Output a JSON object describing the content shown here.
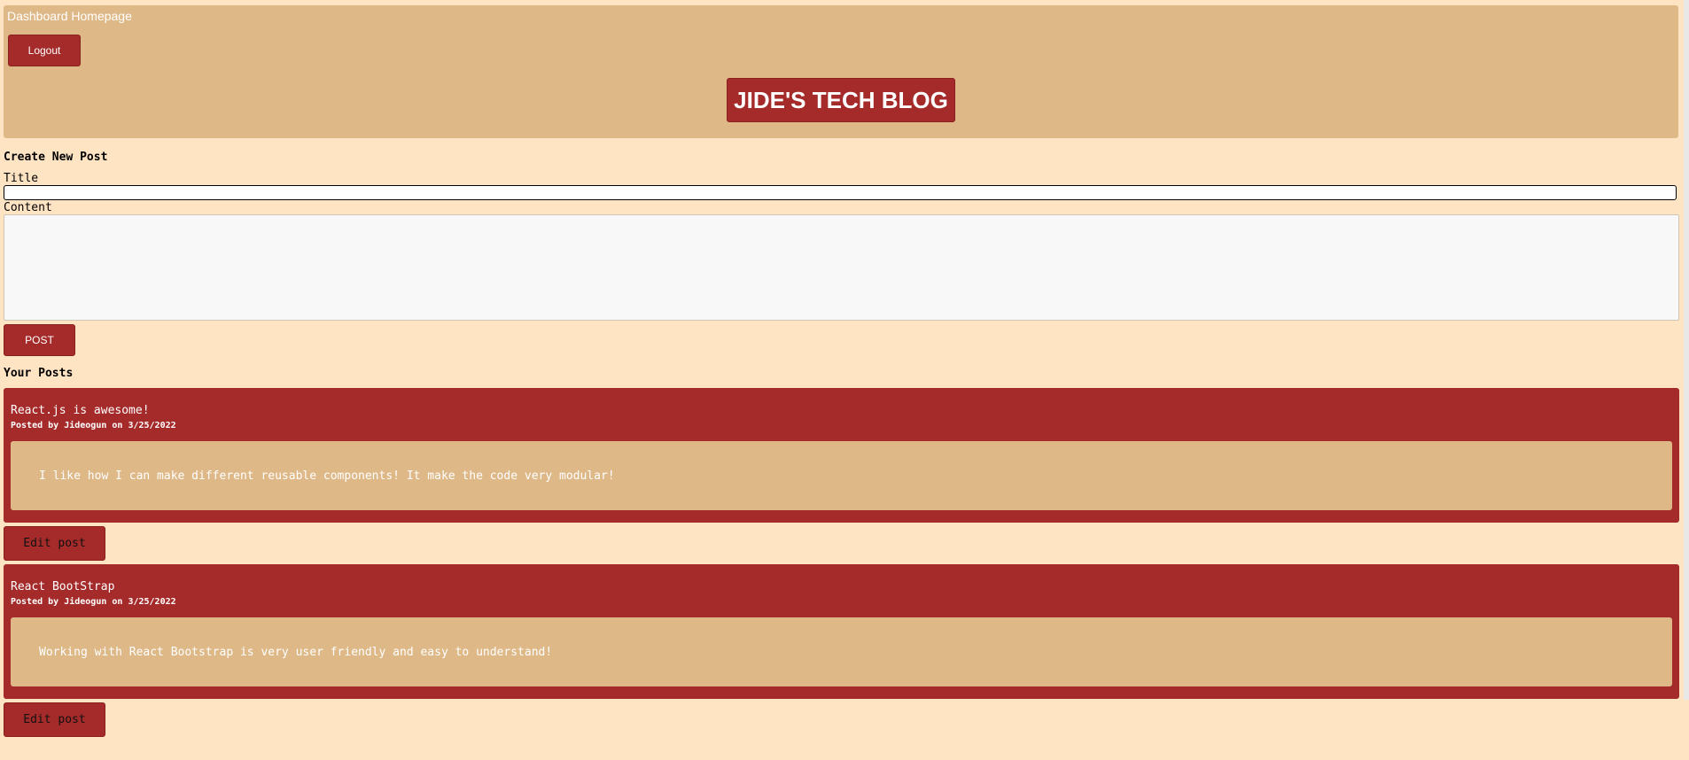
{
  "header": {
    "title": "Dashboard Homepage",
    "logout_label": "Logout",
    "brand": "JIDE'S TECH BLOG"
  },
  "create_post": {
    "heading": "Create New Post",
    "title_label": "Title",
    "title_value": "",
    "content_label": "Content",
    "content_value": "",
    "submit_label": "POST"
  },
  "your_posts": {
    "heading": "Your Posts",
    "edit_label": "Edit post",
    "posts": [
      {
        "title": "React.js is awesome!",
        "meta": "Posted by Jideogun on 3/25/2022",
        "body": "I like how I can make different reusable components! It make the code very modular!"
      },
      {
        "title": "React BootStrap",
        "meta": "Posted by Jideogun on 3/25/2022",
        "body": "Working with React Bootstrap is very user friendly and easy to understand!"
      }
    ]
  },
  "colors": {
    "page_bg": "#ffe4c4",
    "header_bg": "#deb887",
    "accent": "#a52a2a"
  }
}
